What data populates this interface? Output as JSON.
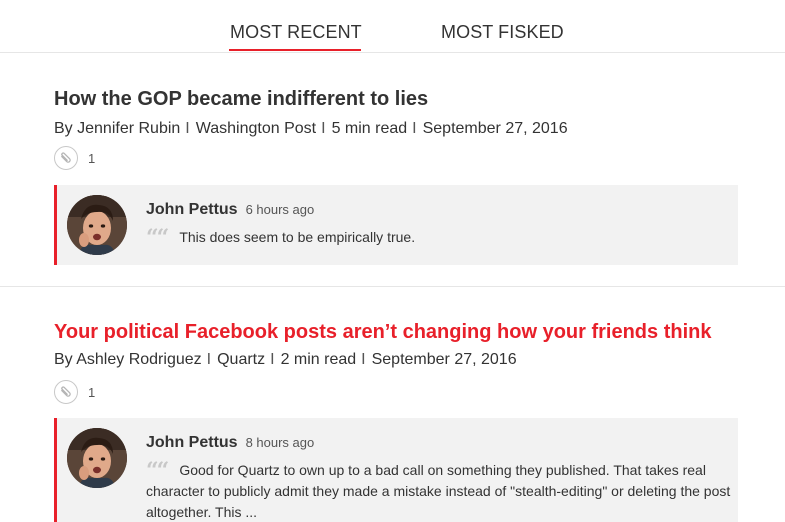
{
  "tabs": {
    "most_recent": "MOST RECENT",
    "most_fisked": "MOST FISKED",
    "active": "most_recent"
  },
  "articles": [
    {
      "title": "How the GOP became indifferent to lies",
      "author": "By Jennifer Rubin",
      "source": "Washington Post",
      "read_time": "5 min read",
      "date": "September 27, 2016",
      "separator": "I",
      "fisk_count": "1",
      "title_color": "#333333",
      "comment": {
        "author": "John Pettus",
        "time": "6 hours ago",
        "quote_mark": "““",
        "text": "This does seem to be empirically true."
      }
    },
    {
      "title": "Your political Facebook posts aren’t changing how your friends think",
      "author": "By Ashley Rodriguez",
      "source": "Quartz",
      "read_time": "2 min read",
      "date": "September 27, 2016",
      "separator": "I",
      "fisk_count": "1",
      "title_color": "#e8202a",
      "comment": {
        "author": "John Pettus",
        "time": "8 hours ago",
        "quote_mark": "““",
        "text": "Good for Quartz to own up to a bad call on something they published. That takes real character to publicly admit they made a mistake instead of \"stealth-editing\" or deleting the post altogether. This ..."
      }
    }
  ],
  "colors": {
    "accent": "#e8202a",
    "comment_bg": "#f2f2f2",
    "text": "#333333"
  },
  "icons": {
    "fisk": "paperclip-icon",
    "avatar": "user-avatar"
  }
}
